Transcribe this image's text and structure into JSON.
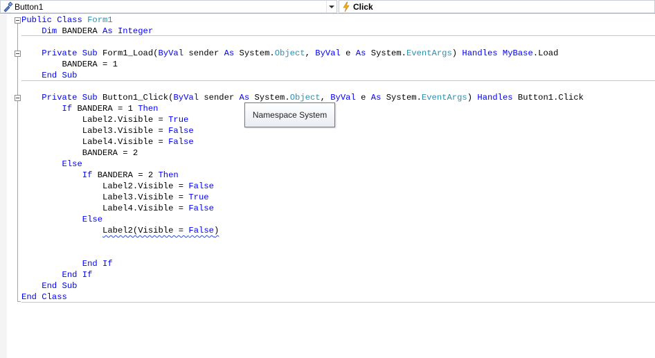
{
  "navigation": {
    "class_dropdown": {
      "value": "Button1",
      "icon": "class-member-icon"
    },
    "method_dropdown": {
      "value": "Click",
      "icon": "lightning-event-icon",
      "icon_color": "#e8a20c"
    }
  },
  "tooltip": {
    "text": "Namespace System"
  },
  "colors": {
    "keyword": "#0000ff",
    "type": "#2b91af",
    "text": "#000000"
  },
  "code_lines": [
    [
      {
        "t": "Public Class ",
        "c": "kw"
      },
      {
        "t": "Form1",
        "c": "ty"
      }
    ],
    [
      {
        "t": "    "
      },
      {
        "t": "Dim",
        "c": "kw"
      },
      {
        "t": " BANDERA "
      },
      {
        "t": "As Integer",
        "c": "kw"
      }
    ],
    [],
    [
      {
        "t": "    "
      },
      {
        "t": "Private Sub",
        "c": "kw"
      },
      {
        "t": " Form1_Load("
      },
      {
        "t": "ByVal",
        "c": "kw"
      },
      {
        "t": " sender "
      },
      {
        "t": "As",
        "c": "kw"
      },
      {
        "t": " System."
      },
      {
        "t": "Object",
        "c": "ty"
      },
      {
        "t": ", "
      },
      {
        "t": "ByVal",
        "c": "kw"
      },
      {
        "t": " e "
      },
      {
        "t": "As",
        "c": "kw"
      },
      {
        "t": " System."
      },
      {
        "t": "EventArgs",
        "c": "ty"
      },
      {
        "t": ") "
      },
      {
        "t": "Handles MyBase",
        "c": "kw"
      },
      {
        "t": ".Load"
      }
    ],
    [
      {
        "t": "        BANDERA = 1"
      }
    ],
    [
      {
        "t": "    "
      },
      {
        "t": "End Sub",
        "c": "kw"
      }
    ],
    [],
    [
      {
        "t": "    "
      },
      {
        "t": "Private Sub",
        "c": "kw"
      },
      {
        "t": " Button1_Click("
      },
      {
        "t": "ByVal",
        "c": "kw"
      },
      {
        "t": " sender "
      },
      {
        "t": "As",
        "c": "kw"
      },
      {
        "t": " System."
      },
      {
        "t": "Object",
        "c": "ty"
      },
      {
        "t": ", "
      },
      {
        "t": "ByVal",
        "c": "kw"
      },
      {
        "t": " e "
      },
      {
        "t": "As",
        "c": "kw"
      },
      {
        "t": " System."
      },
      {
        "t": "EventArgs",
        "c": "ty"
      },
      {
        "t": ") "
      },
      {
        "t": "Handles",
        "c": "kw"
      },
      {
        "t": " Button1.Click"
      }
    ],
    [
      {
        "t": "        "
      },
      {
        "t": "If",
        "c": "kw"
      },
      {
        "t": " BANDERA = 1 "
      },
      {
        "t": "Then",
        "c": "kw"
      }
    ],
    [
      {
        "t": "            Label2.Visible = "
      },
      {
        "t": "True",
        "c": "kw"
      }
    ],
    [
      {
        "t": "            Label3.Visible = "
      },
      {
        "t": "False",
        "c": "kw"
      }
    ],
    [
      {
        "t": "            Label4.Visible = "
      },
      {
        "t": "False",
        "c": "kw"
      }
    ],
    [
      {
        "t": "            BANDERA = 2"
      }
    ],
    [
      {
        "t": "        "
      },
      {
        "t": "Else",
        "c": "kw"
      }
    ],
    [
      {
        "t": "            "
      },
      {
        "t": "If",
        "c": "kw"
      },
      {
        "t": " BANDERA = 2 "
      },
      {
        "t": "Then",
        "c": "kw"
      }
    ],
    [
      {
        "t": "                Label2.Visible = "
      },
      {
        "t": "False",
        "c": "kw"
      }
    ],
    [
      {
        "t": "                Label3.Visible = "
      },
      {
        "t": "True",
        "c": "kw"
      }
    ],
    [
      {
        "t": "                Label4.Visible = "
      },
      {
        "t": "False",
        "c": "kw"
      }
    ],
    [
      {
        "t": "            "
      },
      {
        "t": "Else",
        "c": "kw"
      }
    ],
    [
      {
        "t": "                "
      },
      {
        "t": "Label2(Visible = ",
        "s": true
      },
      {
        "t": "False",
        "c": "kw",
        "s": true
      },
      {
        "t": ")",
        "s": true
      }
    ],
    [],
    [],
    [
      {
        "t": "            "
      },
      {
        "t": "End If",
        "c": "kw"
      }
    ],
    [
      {
        "t": "        "
      },
      {
        "t": "End If",
        "c": "kw"
      }
    ],
    [
      {
        "t": "    "
      },
      {
        "t": "End Sub",
        "c": "kw"
      }
    ],
    [
      {
        "t": "End Class",
        "c": "kw"
      }
    ]
  ]
}
